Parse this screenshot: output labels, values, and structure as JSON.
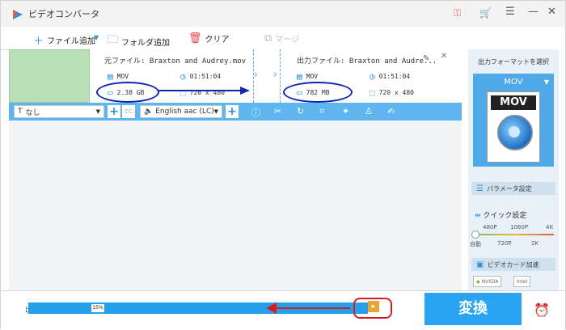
{
  "window": {
    "title": "ビデオコンバータ"
  },
  "toolbar": {
    "add_file": "ファイル追加",
    "add_folder": "フォルダ追加",
    "clear": "クリア",
    "merge": "マージ"
  },
  "file": {
    "source_label": "元ファイル:",
    "source_name": "Braxton and Audrey.mov",
    "output_label": "出力ファイル:",
    "output_name": "Braxton and Audre...",
    "source": {
      "format": "MOV",
      "duration": "01:51:04",
      "size": "2.38 GB",
      "resolution": "720 x 480"
    },
    "output": {
      "format": "MOV",
      "duration": "01:51:04",
      "size": "782 MB",
      "resolution": "720 x 480"
    }
  },
  "options": {
    "subtitle": "なし",
    "audio": "English aac (LC)"
  },
  "panel": {
    "select_format_label": "出力フォーマットを選択",
    "format_name": "MOV",
    "format_icon_text": "MOV",
    "param_button": "パラメータ設定",
    "quick_settings": "クイック設定",
    "ticks_top": [
      "480P",
      "1080P",
      "4K"
    ],
    "ticks_bottom": [
      "自動",
      "720P",
      "2K"
    ],
    "gpu_button": "ビデオカード加速",
    "nvidia": "NVIDIA",
    "intel": "Intel"
  },
  "bottom": {
    "output_label": "出",
    "progress_percent": "15%",
    "progress_value": 15,
    "convert_label": "変換"
  },
  "colors": {
    "accent": "#29a4f3",
    "annotation_blue": "#1226b6",
    "annotation_red": "#d21f1f"
  }
}
